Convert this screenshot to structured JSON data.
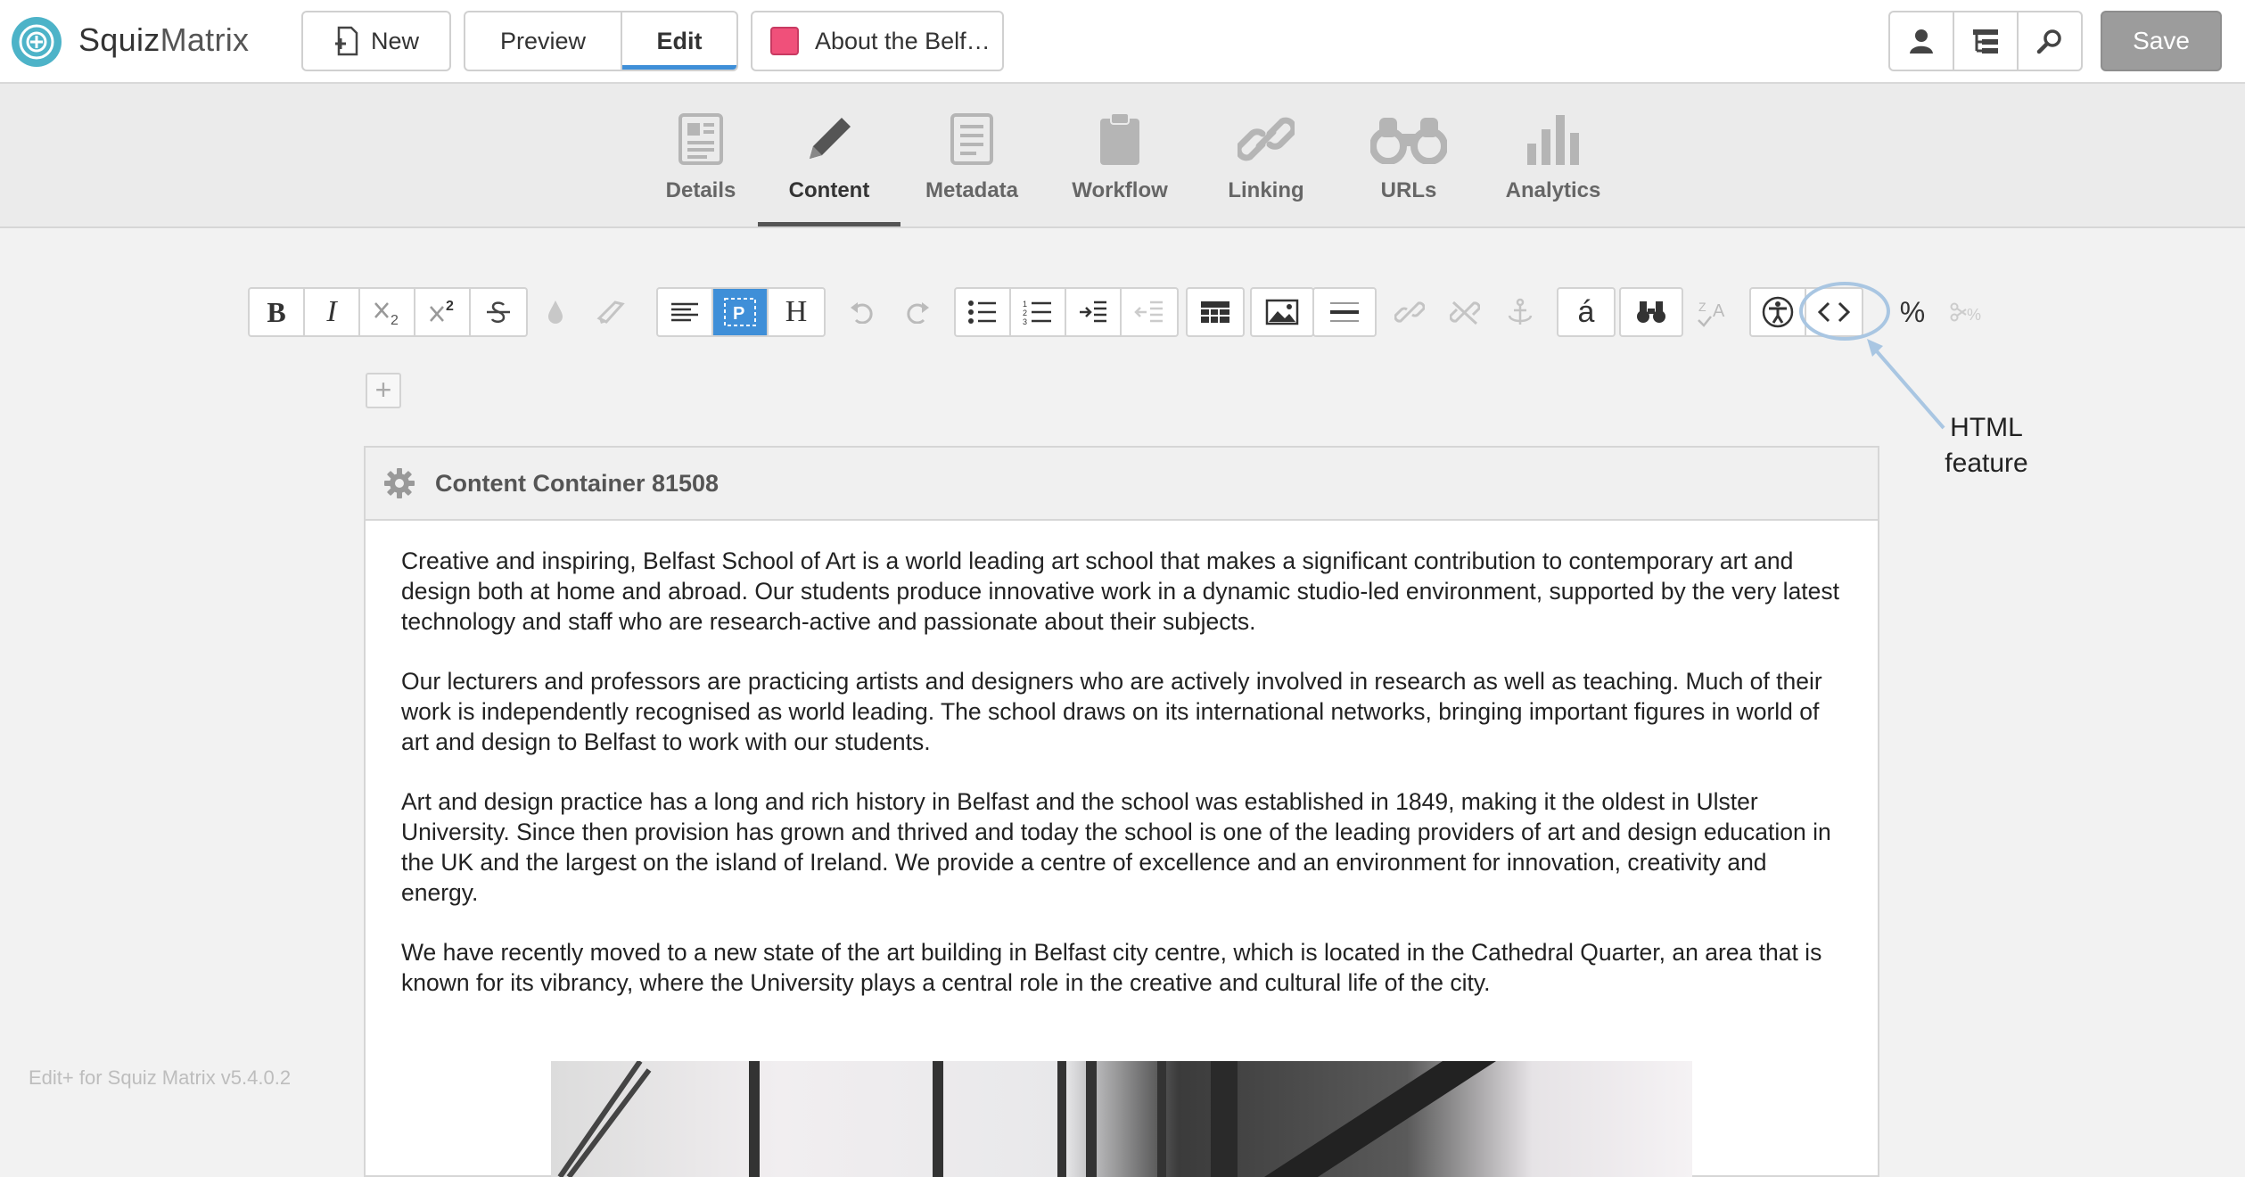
{
  "app": {
    "brand_main": "Squiz",
    "brand_light": "Matrix"
  },
  "topbar": {
    "new_label": "New",
    "preview_label": "Preview",
    "edit_label": "Edit",
    "asset_title": "About the Belf…",
    "asset_color": "#f0507a",
    "save_label": "Save"
  },
  "tabs": [
    {
      "label": "Details",
      "icon": "details-icon"
    },
    {
      "label": "Content",
      "icon": "pencil-icon",
      "active": true
    },
    {
      "label": "Metadata",
      "icon": "metadata-icon"
    },
    {
      "label": "Workflow",
      "icon": "clipboard-icon"
    },
    {
      "label": "Linking",
      "icon": "link-icon"
    },
    {
      "label": "URLs",
      "icon": "binoculars-icon"
    },
    {
      "label": "Analytics",
      "icon": "bar-chart-icon"
    }
  ],
  "toolbar": {
    "bold": "B",
    "italic": "I",
    "heading": "H",
    "percent": "%",
    "accent_char": "á"
  },
  "annotation": {
    "line1": "HTML",
    "line2": "feature"
  },
  "container": {
    "title": "Content Container 81508",
    "paragraphs": [
      "Creative and inspiring, Belfast School of Art is a world leading art school that makes a significant contribution to contemporary art and design both at home and abroad. Our students produce innovative work in a dynamic studio-led environment, supported by the very latest technology and staff who are research-active and passionate about their subjects.",
      "Our lecturers and professors are practicing artists and designers who are actively involved in research as well as teaching. Much of their work is independently recognised as world leading. The school draws on its international networks, bringing important figures in world of art and design to Belfast to work with our students.",
      "Art and design practice has a long and rich history in Belfast and the school was established in 1849, making it the oldest in Ulster University. Since then provision has grown and thrived and today the school is one of the leading providers of art and design education in the UK and the largest on the island of Ireland. We provide a centre of excellence and an environment for innovation, creativity and energy.",
      "We have recently moved to a new state of the art building in Belfast city centre, which is located in the Cathedral Quarter, an area that is known for its vibrancy, where the University plays a central role in the creative and cultural life of the city."
    ]
  },
  "footer": {
    "version": "Edit+ for Squiz Matrix v5.4.0.2"
  },
  "colors": {
    "accent": "#3f8fd8",
    "save_bg": "#9c9c9c",
    "logo": "#4db3c8"
  }
}
